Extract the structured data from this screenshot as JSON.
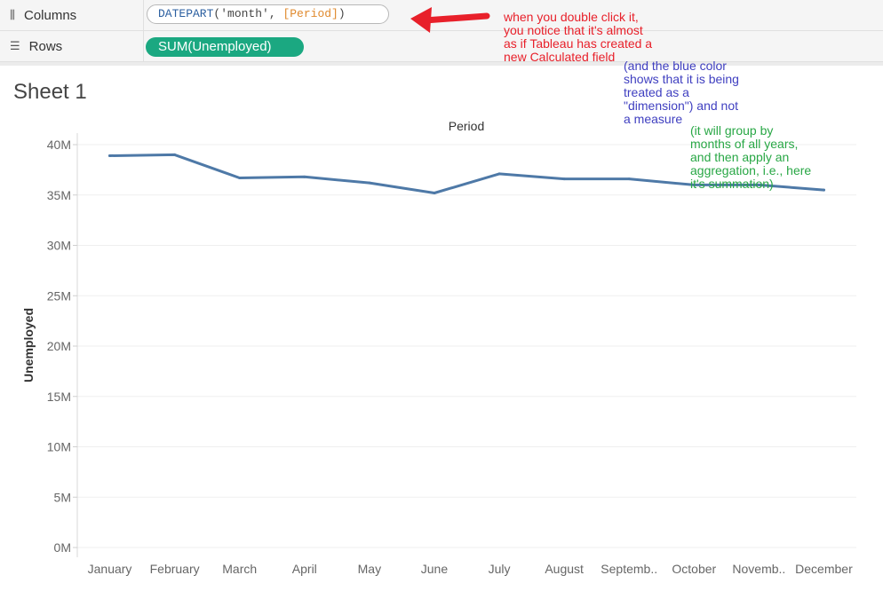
{
  "shelves": {
    "columns": {
      "label": "Columns",
      "icon": "columns-icon"
    },
    "rows": {
      "label": "Rows",
      "icon": "rows-icon"
    },
    "formula": {
      "fn": "DATEPART",
      "arg_open": "('month', ",
      "field": "[Period]",
      "close": ")"
    },
    "measure": "SUM(Unemployed)"
  },
  "sheet": {
    "title": "Sheet 1"
  },
  "annotations": {
    "red": [
      "when you double click it,",
      "you notice that it's almost",
      "as if Tableau has created a",
      "new Calculated field"
    ],
    "blue": [
      "(and the blue color",
      "shows that it is being",
      "treated as a",
      "\"dimension\") and not",
      "a measure"
    ],
    "green": [
      "(it will group by",
      "months of all years,",
      "and then apply an",
      "aggregation, i.e., here",
      "it's summation)"
    ],
    "colors": {
      "red": "#e8202a",
      "blue": "#3f3fc0",
      "green": "#28a745"
    }
  },
  "chart_data": {
    "type": "line",
    "title": "Period",
    "ylabel": "Unemployed",
    "categories": [
      "January",
      "February",
      "March",
      "April",
      "May",
      "June",
      "July",
      "August",
      "Septemb..",
      "October",
      "Novemb..",
      "December"
    ],
    "values": [
      38.9,
      39.0,
      36.7,
      36.8,
      36.2,
      35.2,
      37.1,
      36.6,
      36.6,
      36.0,
      36.0,
      35.5
    ],
    "yticks": [
      "0M",
      "5M",
      "10M",
      "15M",
      "20M",
      "25M",
      "30M",
      "35M",
      "40M"
    ],
    "ylim": [
      0,
      40
    ],
    "grid": true,
    "line_color": "#4e79a7"
  }
}
